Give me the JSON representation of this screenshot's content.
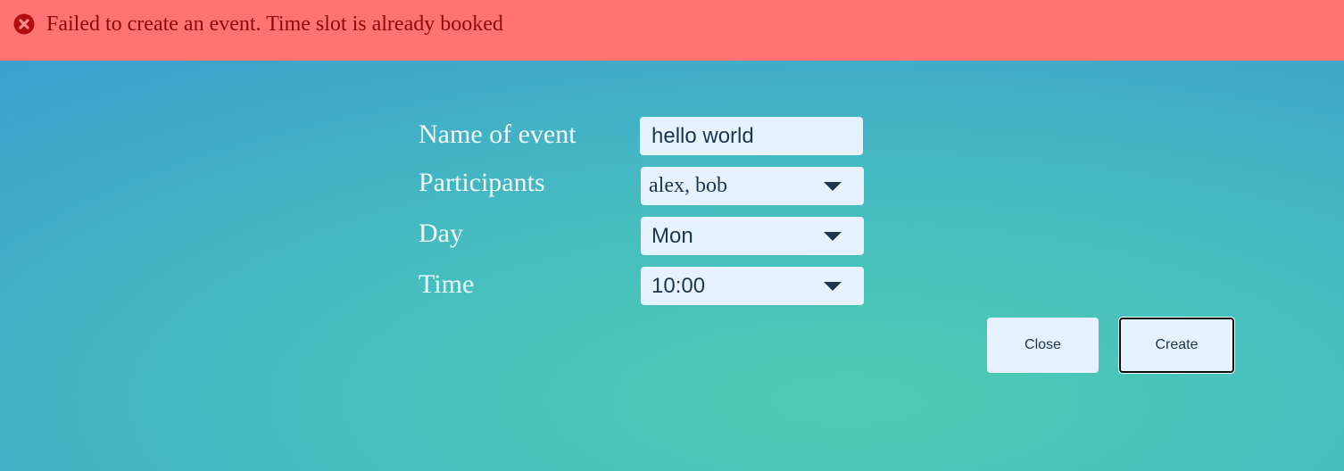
{
  "error": {
    "icon": "error-circle-x-icon",
    "message": "Failed to create an event. Time slot is already booked",
    "colors": {
      "background": "#ff7472",
      "text": "#8a0a0a",
      "icon": "#b30d0d"
    }
  },
  "form": {
    "name": {
      "label": "Name of event",
      "value": "hello world"
    },
    "participants": {
      "label": "Participants",
      "value": "alex, bob",
      "icon": "chevron-down-icon"
    },
    "day": {
      "label": "Day",
      "value": "Mon",
      "icon": "chevron-down-icon"
    },
    "time": {
      "label": "Time",
      "value": "10:00",
      "icon": "chevron-down-icon"
    }
  },
  "actions": {
    "close_label": "Close",
    "create_label": "Create"
  }
}
